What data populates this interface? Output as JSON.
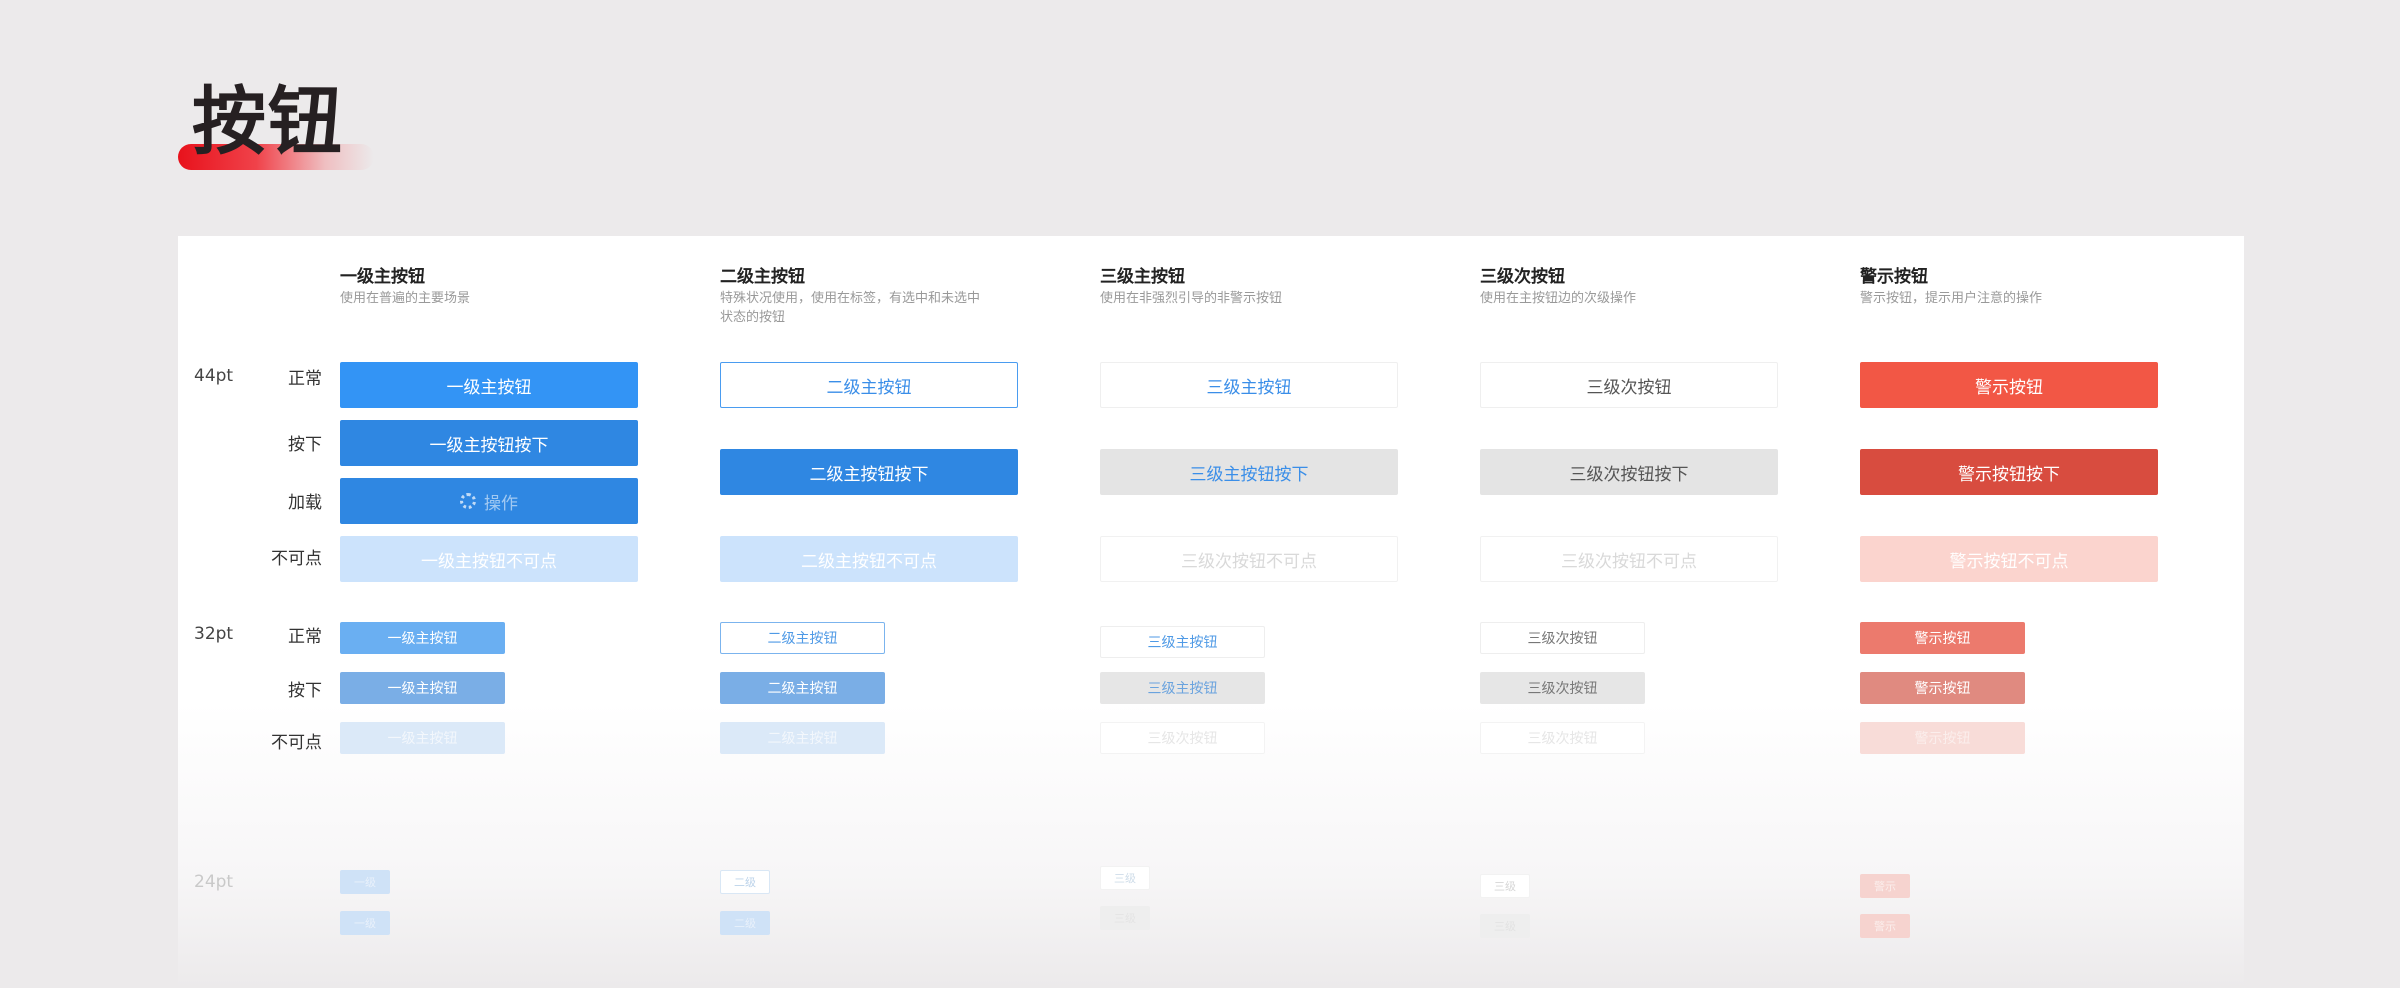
{
  "page": {
    "title": "按钮"
  },
  "columns": [
    {
      "title": "一级主按钮",
      "desc": [
        "使用在普遍的主要场景"
      ]
    },
    {
      "title": "二级主按钮",
      "desc": [
        "特殊状况使用，使用在标签，有选中和未选中",
        "状态的按钮"
      ]
    },
    {
      "title": "三级主按钮",
      "desc": [
        "使用在非强烈引导的非警示按钮"
      ]
    },
    {
      "title": "三级次按钮",
      "desc": [
        "使用在主按钮边的次级操作"
      ]
    },
    {
      "title": "警示按钮",
      "desc": [
        "警示按钮，提示用户注意的操作"
      ]
    }
  ],
  "sizes": {
    "s44": "44pt",
    "s32": "32pt",
    "s24": "24pt"
  },
  "states": {
    "normal": "正常",
    "pressed": "按下",
    "loading": "加载",
    "disabled": "不可点"
  },
  "buttons44": {
    "primary": {
      "normal": "一级主按钮",
      "pressed": "一级主按钮按下",
      "loading": "操作",
      "disabled": "一级主按钮不可点"
    },
    "secondary": {
      "normal": "二级主按钮",
      "pressed": "二级主按钮按下",
      "disabled": "二级主按钮不可点"
    },
    "tertiary": {
      "normal": "三级主按钮",
      "pressed": "三级主按钮按下",
      "disabled": "三级次按钮不可点"
    },
    "tertiary_secondary": {
      "normal": "三级次按钮",
      "pressed": "三级次按钮按下",
      "disabled": "三级次按钮不可点"
    },
    "warning": {
      "normal": "警示按钮",
      "pressed": "警示按钮按下",
      "disabled": "警示按钮不可点"
    }
  },
  "buttons32": {
    "primary": {
      "normal": "一级主按钮",
      "pressed": "一级主按钮",
      "disabled": "一级主按钮"
    },
    "secondary": {
      "normal": "二级主按钮",
      "pressed": "二级主按钮",
      "disabled": "二级主按钮"
    },
    "tertiary": {
      "normal": "三级主按钮",
      "pressed": "三级主按钮",
      "disabled": "三级次按钮"
    },
    "tertiary_secondary": {
      "normal": "三级次按钮",
      "pressed": "三级次按钮",
      "disabled": "三级次按钮"
    },
    "warning": {
      "normal": "警示按钮",
      "pressed": "警示按钮",
      "disabled": "警示按钮"
    }
  },
  "buttons24": {
    "primary": {
      "normal": "一级",
      "pressed": "一级"
    },
    "secondary": {
      "normal": "二级",
      "pressed": "二级"
    },
    "tertiary": {
      "normal": "三级",
      "pressed": "三级"
    },
    "tertiary_secondary": {
      "normal": "三级",
      "pressed": "三级"
    },
    "warning": {
      "normal": "警示",
      "pressed": "警示"
    }
  },
  "colors": {
    "primary": "#3394f5",
    "primary_pressed": "#2f87e2",
    "primary_disabled": "#cce3fc",
    "warning": "#f25745",
    "warning_pressed": "#d84c3f",
    "warning_disabled": "#fbd4ce",
    "title_accent": "#e8121c"
  }
}
